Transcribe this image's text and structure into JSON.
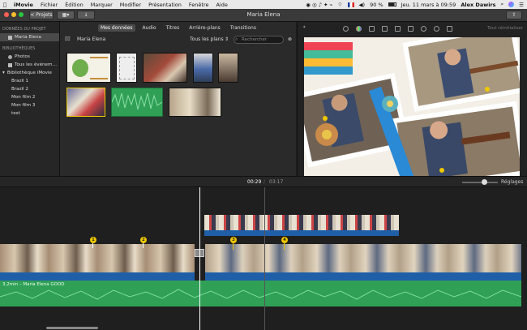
{
  "menubar": {
    "app": "iMovie",
    "items": [
      "Fichier",
      "Édition",
      "Marquer",
      "Modifier",
      "Présentation",
      "Fenêtre",
      "Aide"
    ],
    "battery": "90 %",
    "datetime": "Jeu. 11 mars à 09:59",
    "user": "Alex Dawirs"
  },
  "toolbar": {
    "back_label": "Projets",
    "window_title": "Maria Elena"
  },
  "sidebar": {
    "project_header": "DONNÉES DU PROJET",
    "project_item": "Maria Elena",
    "libraries_header": "BIBLIOTHÈQUES",
    "photos": "Photos",
    "all_events": "Tous les événem…",
    "library": "Bibliothèque iMovie",
    "events": [
      "Brazil 1",
      "Brazil 2",
      "Mon film 2",
      "Mon film 3",
      "test"
    ]
  },
  "browser": {
    "tabs": [
      "Mes données",
      "Audio",
      "Titres",
      "Arrière-plans",
      "Transitions"
    ],
    "project_name": "Maria Elena",
    "filter": "Tous les plans",
    "search_placeholder": "Rechercher"
  },
  "viewer": {
    "reset_label": "Tout réinitialiser"
  },
  "timeline": {
    "current_time": "00:29",
    "total_time": "03:17",
    "settings_label": "Réglages",
    "audio_label": "3,2min – Maria Elena GOOD"
  },
  "markers": [
    "1",
    "2",
    "3",
    "4"
  ],
  "colors": {
    "audio_green": "#2fa055",
    "clip_blue": "#1f5fa8",
    "marker_yellow": "#f0c800",
    "selection_yellow": "#f0c800"
  }
}
